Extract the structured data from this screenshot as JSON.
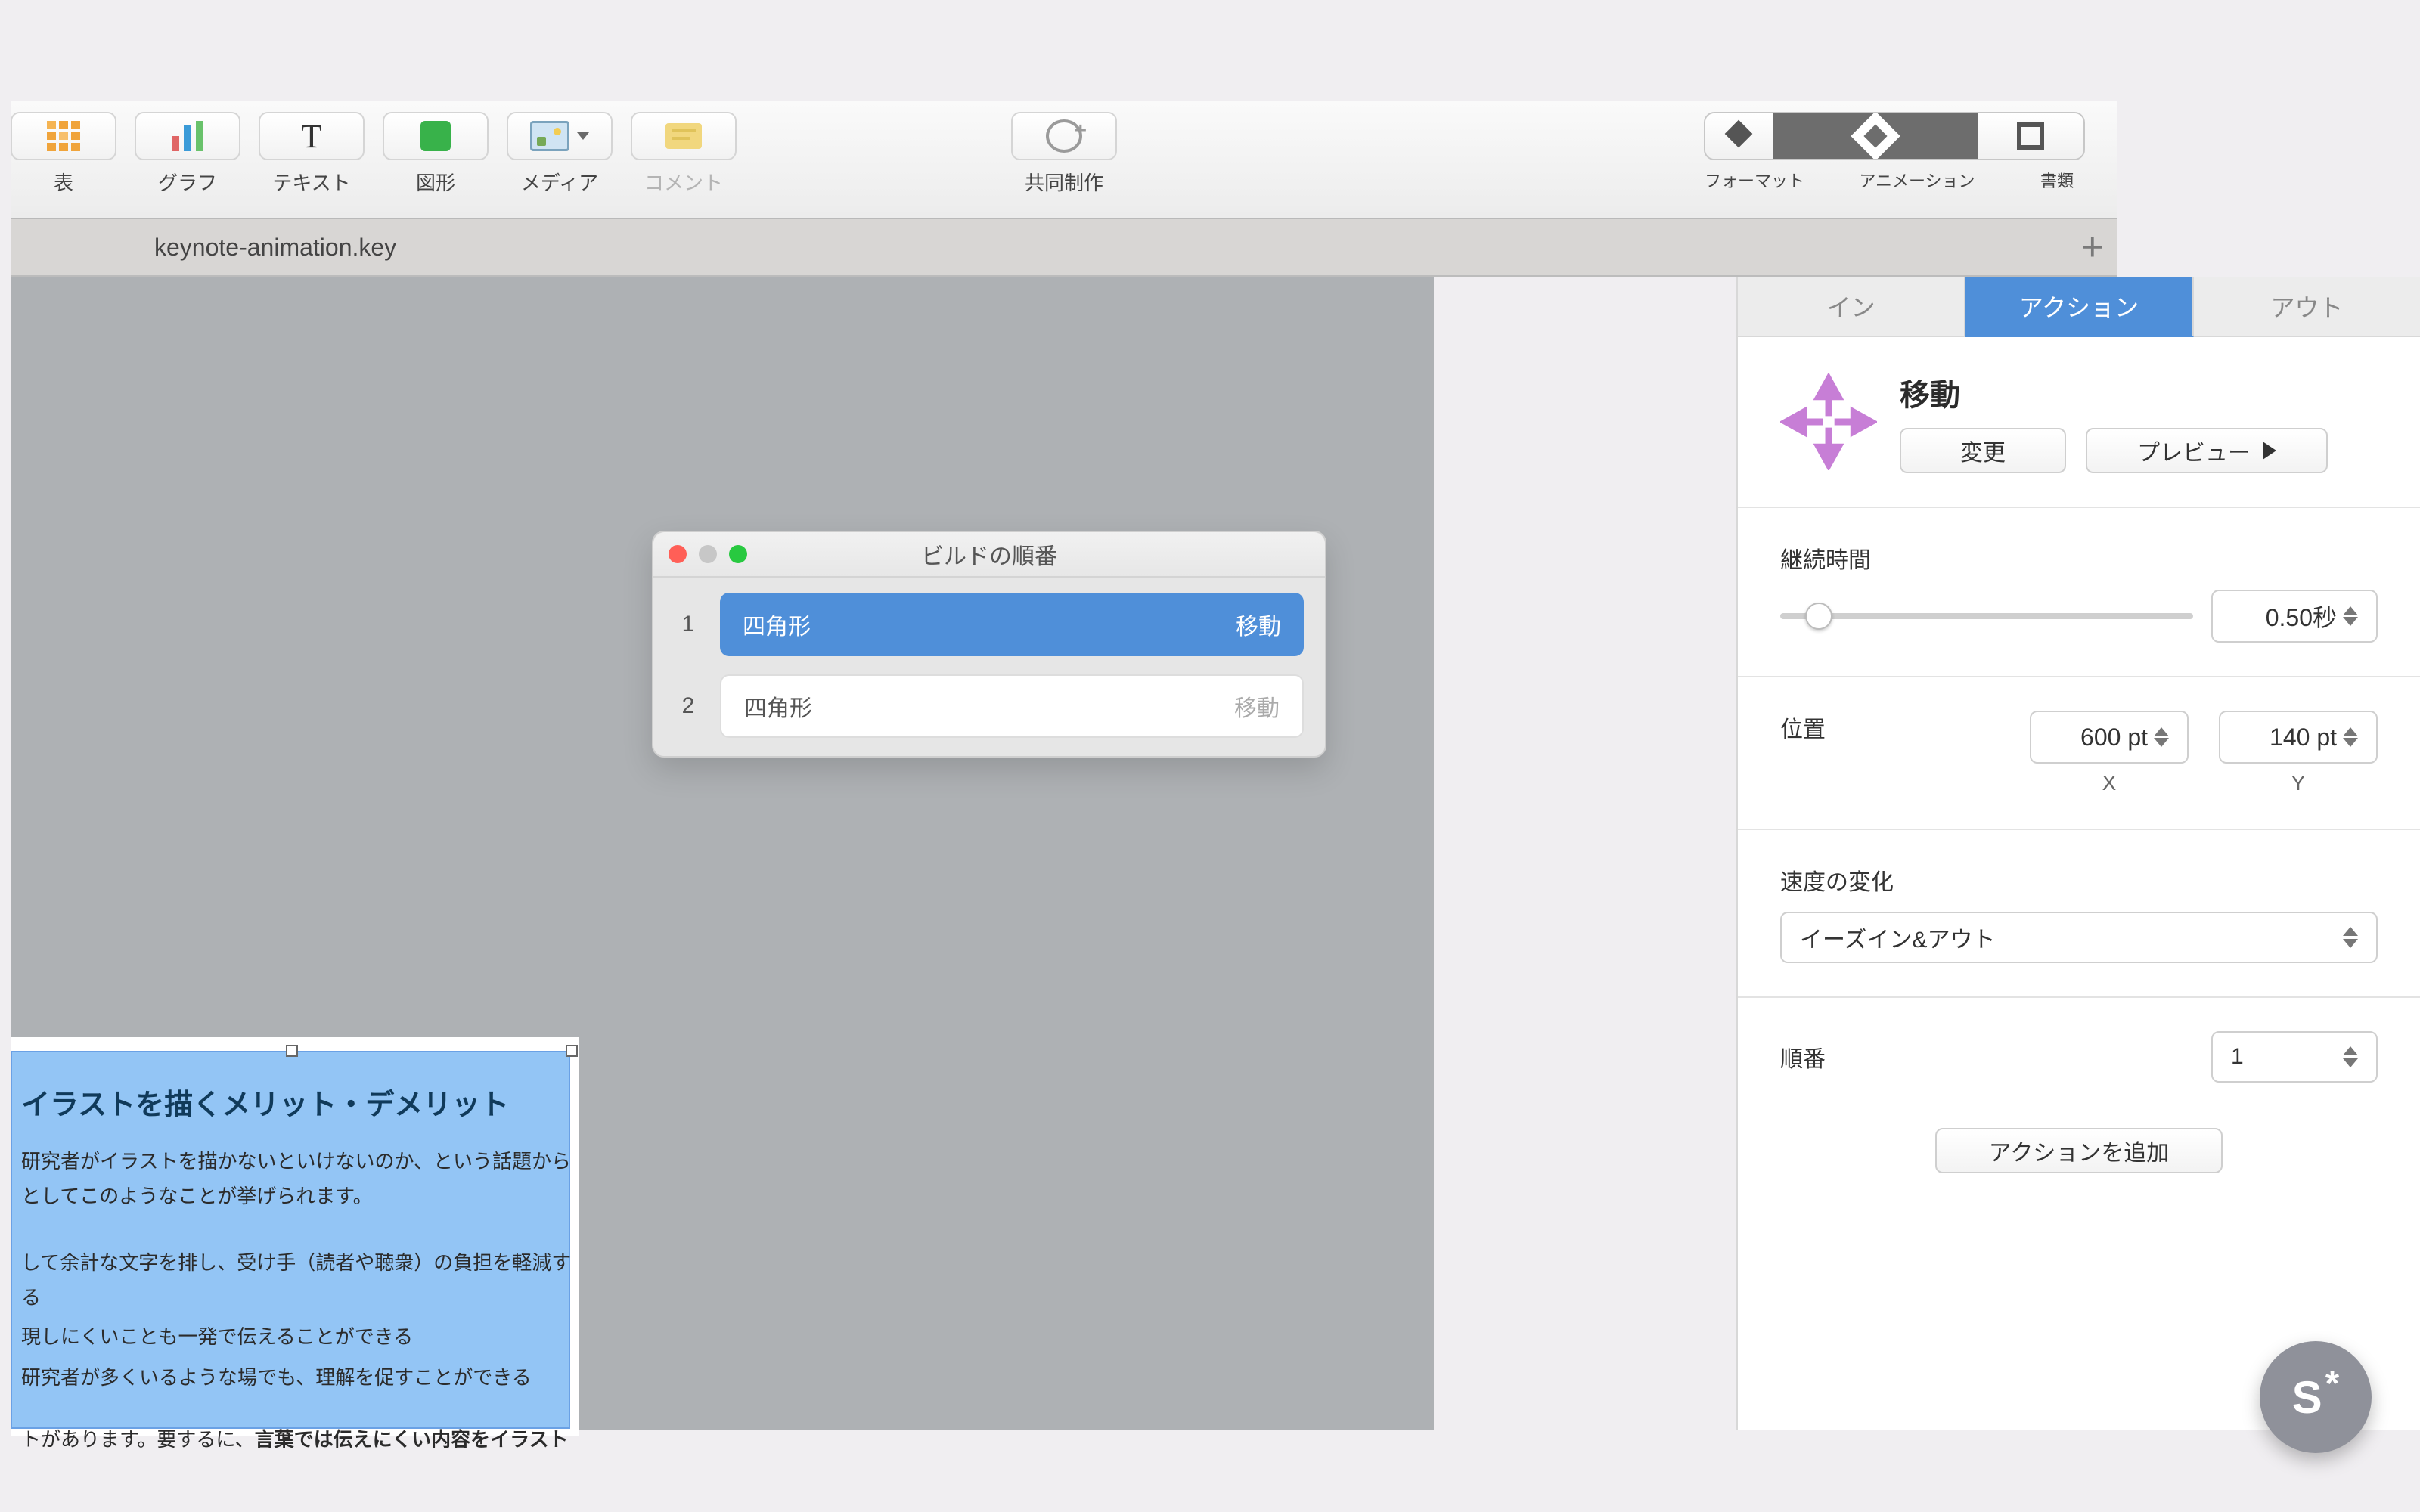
{
  "toolbar": {
    "table": "表",
    "chart": "グラフ",
    "text": "テキスト",
    "shape": "図形",
    "media": "メディア",
    "comment": "コメント",
    "collab": "共同制作",
    "format": "フォーマット",
    "animation": "アニメーション",
    "document": "書類"
  },
  "tabbar": {
    "filename": "keynote-animation.key"
  },
  "popover": {
    "title": "ビルドの順番",
    "rows": [
      {
        "idx": "1",
        "object": "四角形",
        "action": "移動"
      },
      {
        "idx": "2",
        "object": "四角形",
        "action": "移動"
      }
    ]
  },
  "inspector": {
    "tabs": {
      "in": "イン",
      "action": "アクション",
      "out": "アウト"
    },
    "effect_name": "移動",
    "change": "変更",
    "preview": "プレビュー",
    "duration_label": "継続時間",
    "duration_value": "0.50秒",
    "position_label": "位置",
    "pos_x": "600 pt",
    "pos_y": "140 pt",
    "x": "X",
    "y": "Y",
    "accel_label": "速度の変化",
    "accel_value": "イーズイン&アウト",
    "order_label": "順番",
    "order_value": "1",
    "add_action": "アクションを追加"
  },
  "slide": {
    "title": "イラストを描くメリット・デメリット",
    "l1": "研究者がイラストを描かないといけないのか、という話題から",
    "l2": "としてこのようなことが挙げられます。",
    "l3": "して余計な文字を排し、受け手（読者や聴衆）の負担を軽減す",
    "l4": "る",
    "l5": "現しにくいことも一発で伝えることができる",
    "l6": "研究者が多くいるような場でも、理解を促すことができる",
    "l7a": "トがあります。要するに、",
    "l7b": "言葉では伝えにくい内容をイラスト"
  },
  "badge": {
    "s": "S",
    "star": "*"
  }
}
